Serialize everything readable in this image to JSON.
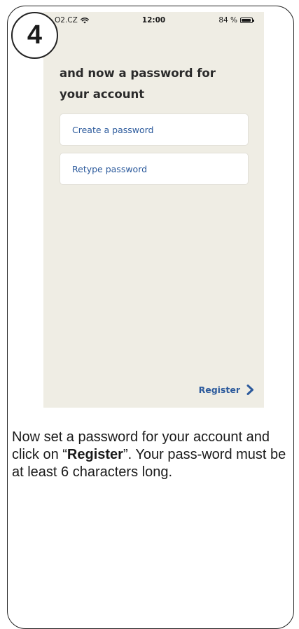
{
  "step": {
    "number": "4"
  },
  "statusbar": {
    "carrier": "O2.CZ",
    "time": "12:00",
    "battery": "84 %",
    "wifi_icon": "wifi-icon",
    "battery_icon": "battery-icon"
  },
  "screen": {
    "heading_line1": "and now a password for",
    "heading_line2": "your account",
    "password_placeholder": "Create a password",
    "retype_placeholder": "Retype password",
    "register_label": "Register",
    "register_icon": "chevron-right-icon"
  },
  "instructions": {
    "text_before": "Now set a password for your account and click on “",
    "bold": "Register",
    "text_after": "”. Your pass-word must be at least 6 characters long."
  },
  "colors": {
    "screen_background": "#efede4",
    "accent_blue": "#2c5a9c",
    "text_dark": "#2a2a2a"
  }
}
